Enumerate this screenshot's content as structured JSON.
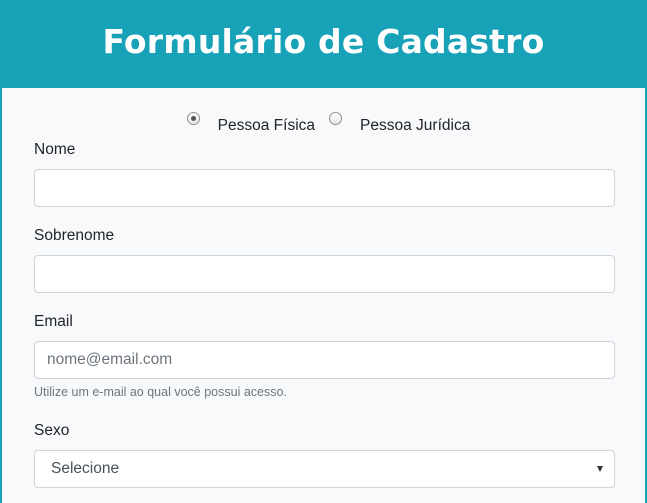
{
  "header": {
    "title": "Formulário de Cadastro"
  },
  "person_type": {
    "options": [
      {
        "label": "Pessoa Física",
        "checked": true
      },
      {
        "label": "Pessoa Jurídica",
        "checked": false
      }
    ]
  },
  "fields": {
    "nome": {
      "label": "Nome",
      "value": ""
    },
    "sobrenome": {
      "label": "Sobrenome",
      "value": ""
    },
    "email": {
      "label": "Email",
      "value": "",
      "placeholder": "nome@email.com",
      "help": "Utilize um e-mail ao qual você possui acesso."
    },
    "sexo": {
      "label": "Sexo",
      "selected": "Selecione"
    }
  },
  "colors": {
    "accent": "#17a2b8",
    "background": "#f8f9fa"
  }
}
